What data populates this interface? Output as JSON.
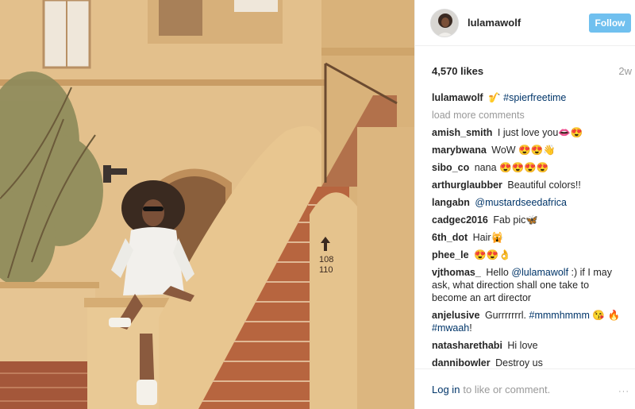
{
  "post": {
    "username": "lulamawolf",
    "follow_label": "Follow",
    "likes": "4,570 likes",
    "time": "2w",
    "caption_user": "lulamawolf",
    "caption_hashtag": "#spierfreetime",
    "load_more": "load more comments",
    "stair_numbers": "108\n110"
  },
  "comments": [
    {
      "user": "amish_smith",
      "text": "I just love you"
    },
    {
      "user": "marybwana",
      "text": "WoW"
    },
    {
      "user": "sibo_co",
      "text": "nana"
    },
    {
      "user": "arthurglaubber",
      "text": "Beautiful colors!!"
    },
    {
      "user": "langabn",
      "text": "@mustardseedafrica"
    },
    {
      "user": "cadgec2016",
      "text": "Fab pic"
    },
    {
      "user": "6th_dot",
      "text": "Hair"
    },
    {
      "user": "phee_le",
      "text": ""
    },
    {
      "user": "vjthomas_",
      "text": "Hello",
      "mention": "@lulamawolf",
      "text2": ":) if I may ask, what direction shall one take to become an art director"
    },
    {
      "user": "anjelusive",
      "text": "Gurrrrrrrl.",
      "hashtag": "#mmmhmmm",
      "hashtag2": "#mwaah",
      "text2": "!"
    },
    {
      "user": "natasharethabi",
      "text": "Hi love"
    },
    {
      "user": "dannibowler",
      "text": "Destroy us"
    }
  ],
  "footer": {
    "login": "Log in",
    "rest": "to like or comment.",
    "more": "···"
  },
  "colors": {
    "follow_bg": "#70c0ef",
    "link": "#003569",
    "muted": "#999999"
  }
}
